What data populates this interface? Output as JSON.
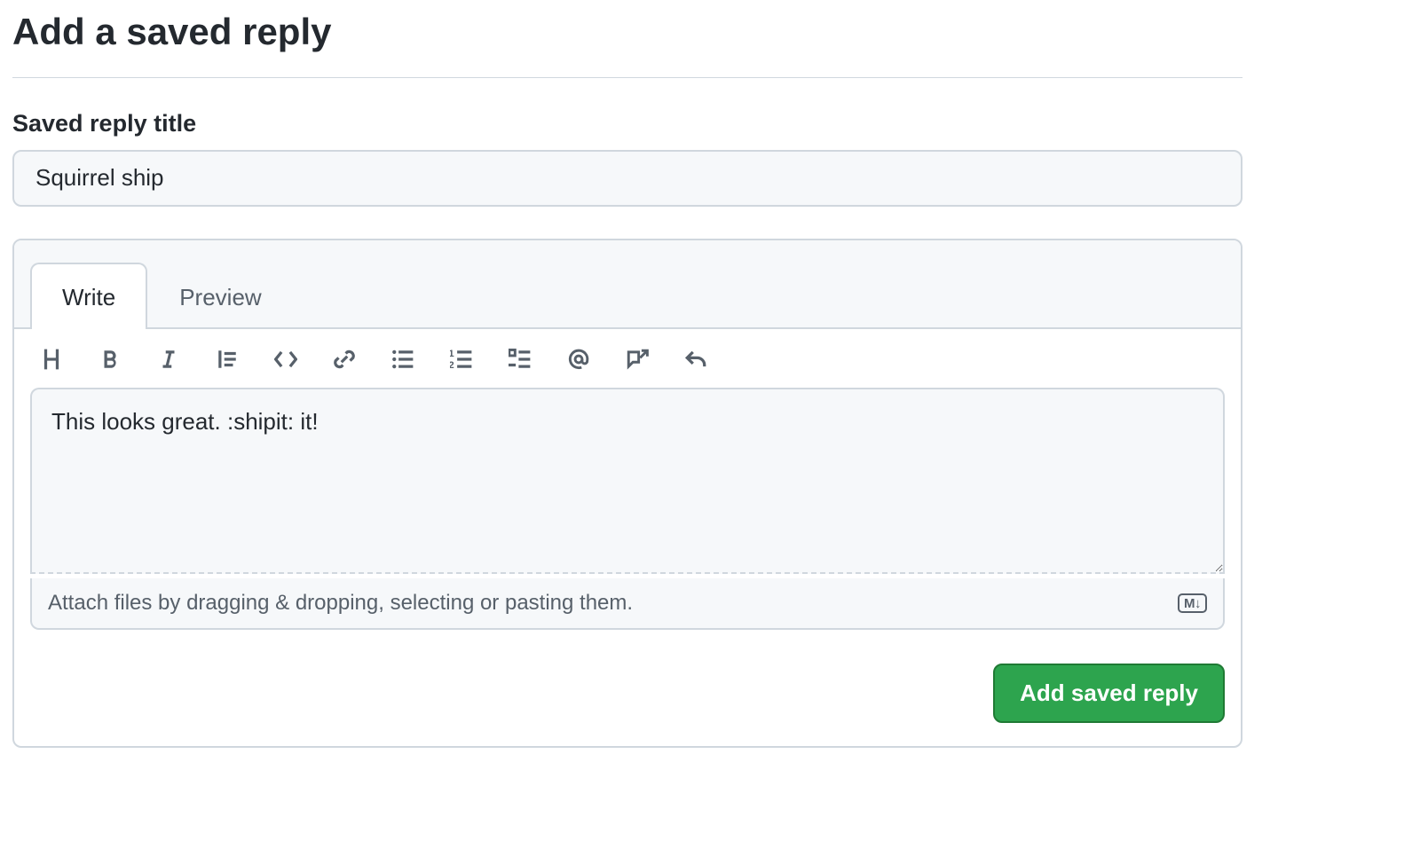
{
  "page": {
    "title": "Add a saved reply"
  },
  "form": {
    "title_label": "Saved reply title",
    "title_value": "Squirrel ship",
    "body_value": "This looks great. :shipit: it!",
    "attach_hint": "Attach files by dragging & dropping, selecting or pasting them.",
    "markdown_badge": "M↓",
    "submit_label": "Add saved reply"
  },
  "tabs": {
    "write": "Write",
    "preview": "Preview",
    "active": "write"
  },
  "toolbar": [
    "heading",
    "bold",
    "italic",
    "quote",
    "code",
    "link",
    "unordered-list",
    "ordered-list",
    "task-list",
    "mention",
    "cross-reference",
    "reply"
  ]
}
